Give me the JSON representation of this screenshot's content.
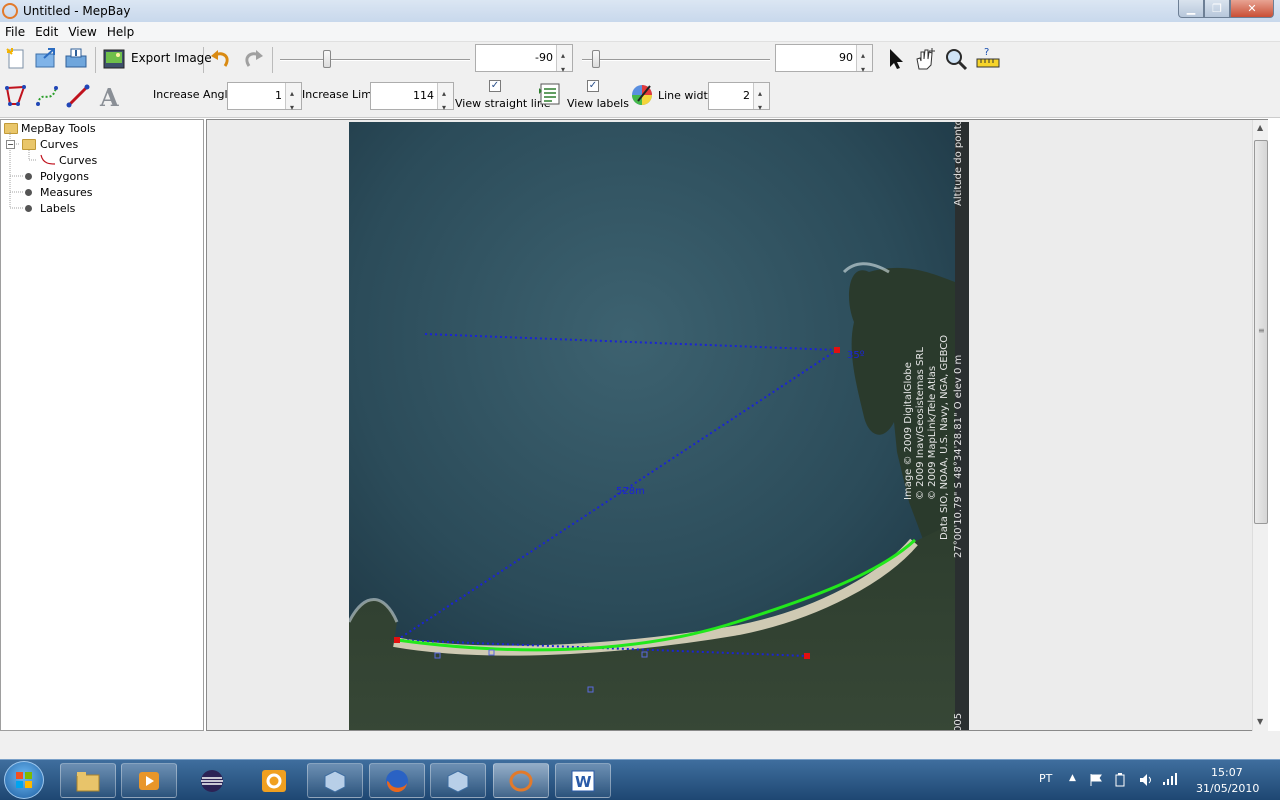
{
  "window": {
    "title": "Untitled - MepBay"
  },
  "menu": {
    "items": [
      "File",
      "Edit",
      "View",
      "Help"
    ]
  },
  "toolbar1": {
    "export_label": "Export Image",
    "angle_min_value": "-90",
    "angle_max_value": "90"
  },
  "toolbar2": {
    "increase_angle_label": "Increase Angle",
    "increase_angle_value": "1",
    "increase_limit_label": "Increase Limit",
    "increase_limit_value": "114",
    "view_straight_line_label": "View straight line",
    "view_straight_line_checked": true,
    "view_labels_label": "View labels",
    "view_labels_checked": true,
    "line_width_label": "Line width",
    "line_width_value": "2"
  },
  "tree": {
    "root": "MepBay Tools",
    "curves_folder": "Curves",
    "curves_item": "Curves",
    "polygons": "Polygons",
    "measures": "Measures",
    "labels": "Labels"
  },
  "map": {
    "angle_label": "35º",
    "distance_label": "528m",
    "credits_line1": "Image © 2009 DigitalGlobe",
    "credits_line2": "© 2009 Inav/Geosistemas SRL",
    "credits_line3": "© 2009 MapLink/Tele Atlas",
    "credits_line4": "Data SIO, NOAA, U.S. Navy, NGA, GEBCO",
    "coords": "27°00'10.79\" S    48°34'28.81\" O    elev    0 m",
    "altitude_label": "Altitude do ponto",
    "edge_text": "005"
  },
  "taskbar": {
    "language": "PT",
    "time": "15:07",
    "date": "31/05/2010"
  },
  "colors": {
    "dotted_line": "#1a23d6",
    "curve": "#22e81c",
    "marker": "#e21010",
    "title_bar": "#c8d8ec",
    "taskbar": "#1e4772"
  }
}
